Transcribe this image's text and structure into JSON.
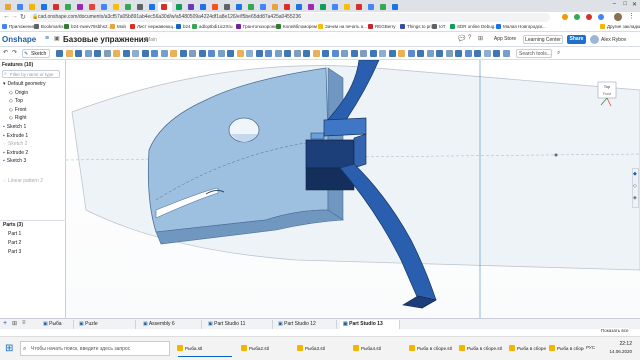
{
  "browser": {
    "url": "cad.onshape.com/documents/a3cf57a05b891ab4ec56a30d/w/a5480509a4224df1a8e126/e/f5be65dd87a425a0455236",
    "bookmarks": [
      "Приложения",
      "Bookmarks",
      "b24-nwev78sbhs2...",
      "Мой",
      "Лист нержавеющ...",
      "b24",
      "adloptbdi1ic2Xru",
      "Грантопохоронки",
      "Колейбломорем",
      "Зачем на печать а...",
      "REGBerry",
      "Things to print",
      "IoT",
      "SDR online Debug...",
      "Малая Новгородск...",
      "Другие закладки"
    ],
    "window_controls": {
      "minimize": "–",
      "maximize": "□",
      "close": "✕"
    }
  },
  "onshape": {
    "logo": "Onshape",
    "doc_title": "Базовые упражнения",
    "doc_sub": "Main",
    "app_store": "App Store",
    "learning_center": "Learning Center",
    "share": "Share",
    "user": "Alex Rybov",
    "search_tools": "Search tools...",
    "sketch_label": "Sketch"
  },
  "features": {
    "header": "Features (10)",
    "filter_placeholder": "Filter by name or type",
    "items": [
      {
        "label": "Default geometry",
        "kind": "group"
      },
      {
        "label": "Origin",
        "kind": "sub"
      },
      {
        "label": "Top",
        "kind": "sub"
      },
      {
        "label": "Front",
        "kind": "sub"
      },
      {
        "label": "Right",
        "kind": "sub"
      },
      {
        "label": "Sketch 1",
        "kind": "item"
      },
      {
        "label": "Extrude 1",
        "kind": "item"
      },
      {
        "label": "Sketch 2",
        "kind": "faded"
      },
      {
        "label": "Extrude 2",
        "kind": "item"
      },
      {
        "label": "Sketch 3",
        "kind": "item"
      },
      {
        "label": "Linear pattern 2",
        "kind": "faded"
      }
    ],
    "parts_header": "Parts (3)",
    "parts": [
      "Part 1",
      "Part 2",
      "Part 3"
    ]
  },
  "viewcube": {
    "label": "Top",
    "side": "Front"
  },
  "bottom_tabs": [
    "Рыба",
    "Puzle",
    "Assembly 6",
    "Part Studio 11",
    "Part Studio 12",
    "Part Studio 13"
  ],
  "taskbar": {
    "search_placeholder": "Чтобы начать поиск, введите здесь запрос",
    "apps": [
      "Рыба.stl",
      "Рыба2.stl",
      "Рыба3.stl",
      "Рыба4.stl",
      "Рыба в сборе.stl",
      "Рыба в сборе.stl",
      "Рыба в сборе.stl",
      "Рыба в сборе.stl"
    ],
    "time": "22:12",
    "date": "14.06.2020",
    "lang": "РУС",
    "notif": "Показать все"
  }
}
